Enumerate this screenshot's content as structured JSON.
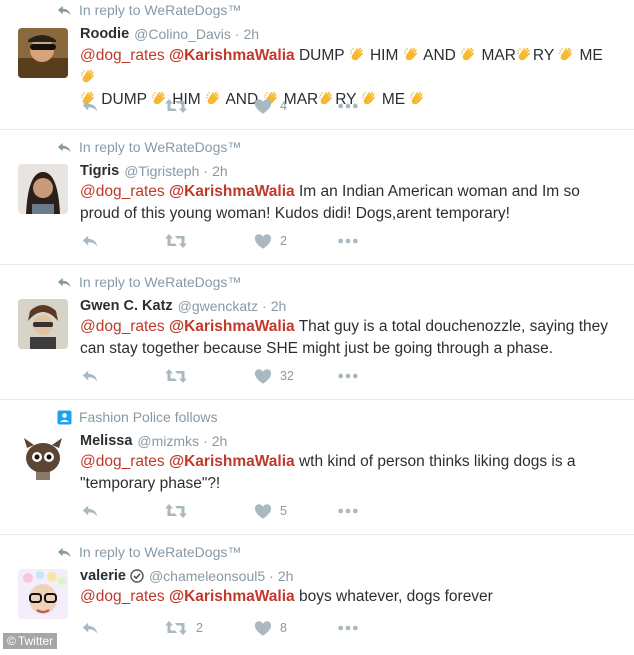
{
  "tweets": [
    {
      "context": "In reply to WeRateDogs™",
      "name": "Roodie",
      "handle": "@Colino_Davis",
      "time": "2h",
      "body_parts": [
        "@dog_rates ",
        "@KarishmaWalia",
        " DUMP ",
        " HIM ",
        " AND ",
        " MAR",
        "RY ",
        " ME ",
        " DUMP ",
        " HIM ",
        " AND ",
        " MAR",
        "RY ",
        " ME "
      ],
      "likes": "4",
      "retweets": ""
    },
    {
      "context": "In reply to WeRateDogs™",
      "name": "Tigris",
      "handle": "@Tigristeph",
      "time": "2h",
      "mention1": "@dog_rates",
      "mention2": "@KarishmaWalia",
      "text": "Im an Indian American woman and Im so proud of this young woman! Kudos didi! Dogs,arent temporary!",
      "likes": "2",
      "retweets": ""
    },
    {
      "context": "In reply to WeRateDogs™",
      "name": "Gwen C. Katz",
      "handle": "@gwenckatz",
      "time": "2h",
      "mention1": "@dog_rates",
      "mention2": "@KarishmaWalia",
      "text": "That guy is a total douchenozzle, saying they can stay together because SHE might just be going through a phase.",
      "likes": "32",
      "retweets": ""
    },
    {
      "context": "Fashion Police follows",
      "name": "Melissa",
      "handle": "@mizmks",
      "time": "2h",
      "mention1": "@dog_rates",
      "mention2": "@KarishmaWalia",
      "text": "wth kind of person thinks liking dogs is a \"temporary phase\"?!",
      "likes": "5",
      "retweets": ""
    },
    {
      "context": "In reply to WeRateDogs™",
      "name": "valerie",
      "handle": "@chameleonsoul5",
      "time": "2h",
      "mention1": "@dog_rates",
      "mention2": "@KarishmaWalia",
      "text": "boys whatever, dogs forever",
      "likes": "8",
      "retweets": "2"
    }
  ],
  "separator": "·",
  "watermark": "Twitter",
  "colors": {
    "mention": "#c0392b",
    "muted": "#8899a6",
    "icon": "#aab8c2",
    "text": "#292f33"
  },
  "icons": [
    "reply-arrow-icon",
    "reply-icon",
    "retweet-icon",
    "heart-icon",
    "more-icon",
    "person-follow-icon",
    "verified-icon",
    "clap-emoji-icon"
  ]
}
